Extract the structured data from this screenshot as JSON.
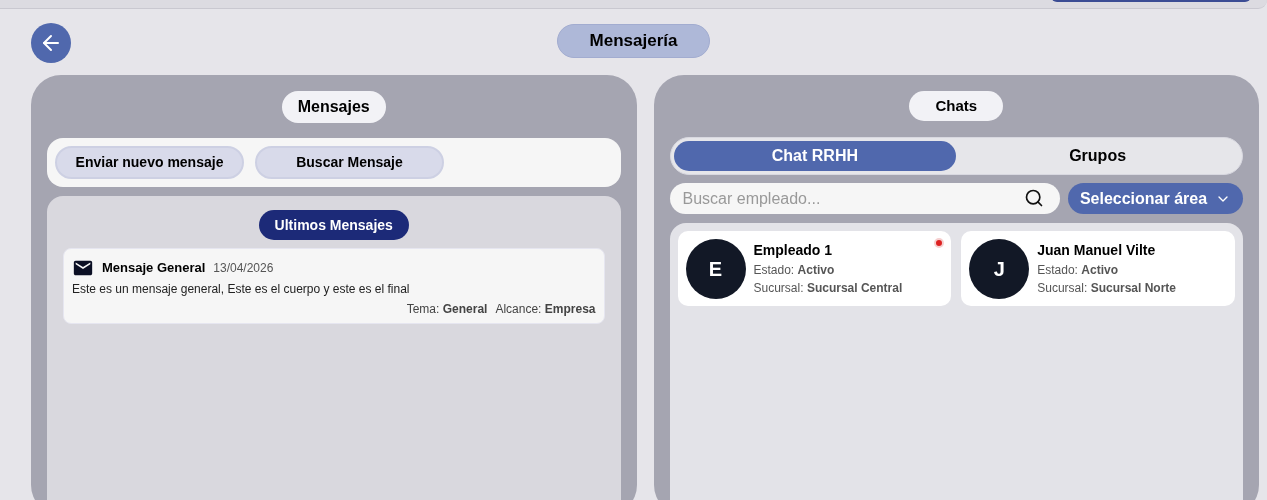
{
  "header": {
    "title": "Mensajería"
  },
  "messages_panel": {
    "title": "Mensajes",
    "actions": [
      "Enviar nuevo mensaje",
      "Buscar Mensaje"
    ],
    "list_title": "Ultimos Mensajes",
    "messages": [
      {
        "subject": "Mensaje General",
        "date": "13/04/2026",
        "body": "Este es un mensaje general, Este es el cuerpo y este es el final",
        "topic_label": "Tema:",
        "topic": "General",
        "scope_label": "Alcance:",
        "scope": "Empresa"
      }
    ]
  },
  "chats_panel": {
    "title": "Chats",
    "tabs": [
      {
        "label": "Chat RRHH",
        "selected": true
      },
      {
        "label": "Grupos",
        "selected": false
      }
    ],
    "search": {
      "placeholder": "Buscar empleado..."
    },
    "area_select": "Seleccionar área",
    "employees": [
      {
        "initial": "E",
        "name": "Empleado 1",
        "status_label": "Estado:",
        "status": "Activo",
        "branch_label": "Sucursal:",
        "branch": "Sucursal Central",
        "unread": true
      },
      {
        "initial": "J",
        "name": "Juan Manuel Vilte",
        "status_label": "Estado:",
        "status": "Activo",
        "branch_label": "Sucursal:",
        "branch": "Sucursal Norte",
        "unread": false
      }
    ]
  }
}
